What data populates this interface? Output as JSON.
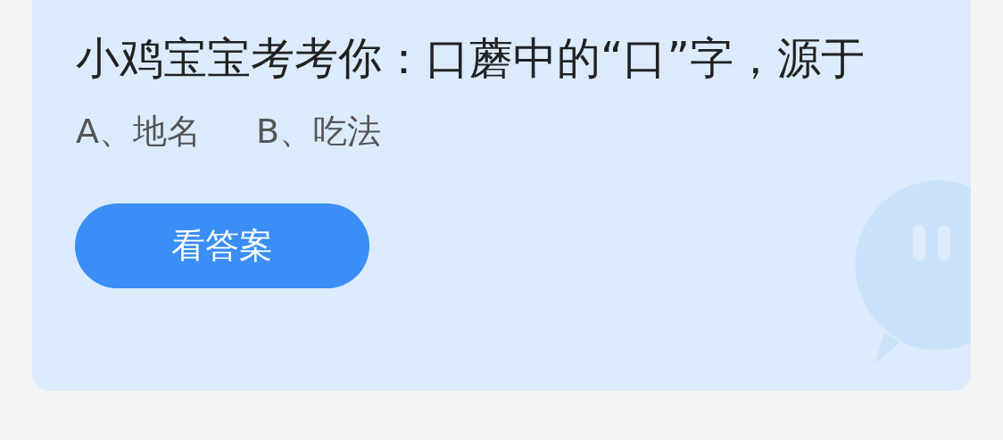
{
  "question": {
    "title": "小鸡宝宝考考你：口蘑中的“口”字，源于",
    "options": [
      "A、地名",
      "B、吃法"
    ]
  },
  "answer_button": {
    "label": "看答案"
  }
}
